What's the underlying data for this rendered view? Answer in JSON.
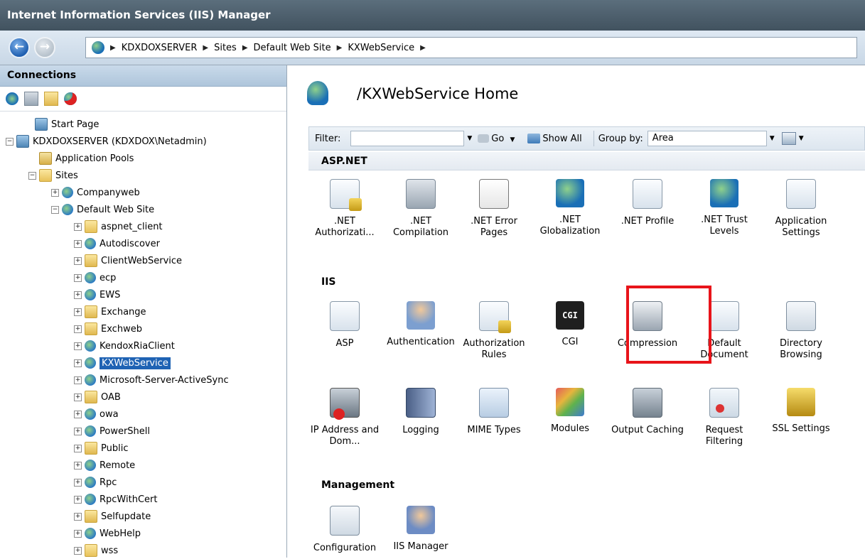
{
  "window": {
    "title": "Internet Information Services (IIS) Manager"
  },
  "address": {
    "crumbs": [
      "KDXDOXSERVER",
      "Sites",
      "Default Web Site",
      "KXWebService"
    ]
  },
  "connections": {
    "header": "Connections",
    "tree": [
      {
        "label": "Start Page",
        "level": 1,
        "icon": "start-page-icon"
      },
      {
        "label": "KDXDOXSERVER (KDXDOX\\Netadmin)",
        "level": 0,
        "icon": "server-icon",
        "expander": "−"
      },
      {
        "label": "Application Pools",
        "level": 1,
        "icon": "app-pool-icon"
      },
      {
        "label": "Sites",
        "level": 1,
        "icon": "sites-icon",
        "expander": "−"
      },
      {
        "label": "Companyweb",
        "level": 2,
        "icon": "site-globe-icon",
        "expander": "+"
      },
      {
        "label": "Default Web Site",
        "level": 2,
        "icon": "site-globe-icon",
        "expander": "−"
      },
      {
        "label": "aspnet_client",
        "level": 3,
        "icon": "folder-icon",
        "expander": "+"
      },
      {
        "label": "Autodiscover",
        "level": 3,
        "icon": "application-icon",
        "expander": "+"
      },
      {
        "label": "ClientWebService",
        "level": 3,
        "icon": "virtual-directory-icon",
        "expander": "+"
      },
      {
        "label": "ecp",
        "level": 3,
        "icon": "application-icon",
        "expander": "+"
      },
      {
        "label": "EWS",
        "level": 3,
        "icon": "application-icon",
        "expander": "+"
      },
      {
        "label": "Exchange",
        "level": 3,
        "icon": "virtual-directory-icon",
        "expander": "+"
      },
      {
        "label": "Exchweb",
        "level": 3,
        "icon": "virtual-directory-icon",
        "expander": "+"
      },
      {
        "label": "KendoxRiaClient",
        "level": 3,
        "icon": "application-icon",
        "expander": "+"
      },
      {
        "label": "KXWebService",
        "level": 3,
        "icon": "application-icon",
        "expander": "+",
        "selected": true
      },
      {
        "label": "Microsoft-Server-ActiveSync",
        "level": 3,
        "icon": "application-icon",
        "expander": "+"
      },
      {
        "label": "OAB",
        "level": 3,
        "icon": "virtual-directory-icon",
        "expander": "+"
      },
      {
        "label": "owa",
        "level": 3,
        "icon": "application-icon",
        "expander": "+"
      },
      {
        "label": "PowerShell",
        "level": 3,
        "icon": "application-icon",
        "expander": "+"
      },
      {
        "label": "Public",
        "level": 3,
        "icon": "virtual-directory-icon",
        "expander": "+"
      },
      {
        "label": "Remote",
        "level": 3,
        "icon": "application-icon",
        "expander": "+"
      },
      {
        "label": "Rpc",
        "level": 3,
        "icon": "application-icon",
        "expander": "+"
      },
      {
        "label": "RpcWithCert",
        "level": 3,
        "icon": "application-icon",
        "expander": "+"
      },
      {
        "label": "Selfupdate",
        "level": 3,
        "icon": "virtual-directory-icon",
        "expander": "+"
      },
      {
        "label": "WebHelp",
        "level": 3,
        "icon": "application-icon",
        "expander": "+"
      },
      {
        "label": "wss",
        "level": 3,
        "icon": "folder-icon",
        "expander": "+"
      }
    ]
  },
  "main": {
    "title": "/KXWebService Home",
    "filter": {
      "label": "Filter:",
      "go": "Go",
      "show_all": "Show All",
      "group_by_label": "Group by:",
      "group_by_value": "Area"
    },
    "sections": {
      "aspnet": "ASP.NET",
      "iis": "IIS",
      "management": "Management"
    },
    "features_aspnet": [
      {
        "label": ".NET Authorizati...",
        "icon": "net-authorization-icon"
      },
      {
        "label": ".NET Compilation",
        "icon": "net-compilation-icon"
      },
      {
        "label": ".NET Error Pages",
        "icon": "net-error-pages-icon"
      },
      {
        "label": ".NET Globalization",
        "icon": "net-globalization-icon"
      },
      {
        "label": ".NET Profile",
        "icon": "net-profile-icon"
      },
      {
        "label": ".NET Trust Levels",
        "icon": "net-trust-levels-icon"
      },
      {
        "label": "Application Settings",
        "icon": "application-settings-icon"
      }
    ],
    "features_iis_row1": [
      {
        "label": "ASP",
        "icon": "asp-icon"
      },
      {
        "label": "Authentication",
        "icon": "authentication-icon"
      },
      {
        "label": "Authorization Rules",
        "icon": "authorization-rules-icon"
      },
      {
        "label": "CGI",
        "icon": "cgi-icon"
      },
      {
        "label": "Compression",
        "icon": "compression-icon"
      },
      {
        "label": "Default Document",
        "icon": "default-document-icon"
      },
      {
        "label": "Directory Browsing",
        "icon": "directory-browsing-icon"
      }
    ],
    "features_iis_row2": [
      {
        "label": "IP Address and Dom...",
        "icon": "ip-address-icon"
      },
      {
        "label": "Logging",
        "icon": "logging-icon"
      },
      {
        "label": "MIME Types",
        "icon": "mime-types-icon"
      },
      {
        "label": "Modules",
        "icon": "modules-icon"
      },
      {
        "label": "Output Caching",
        "icon": "output-caching-icon"
      },
      {
        "label": "Request Filtering",
        "icon": "request-filtering-icon"
      },
      {
        "label": "SSL Settings",
        "icon": "ssl-settings-icon"
      }
    ],
    "features_mgmt": [
      {
        "label": "Configuration",
        "icon": "configuration-editor-icon"
      },
      {
        "label": "IIS Manager",
        "icon": "iis-manager-permissions-icon"
      }
    ],
    "cgi_badge": "CGI",
    "highlight_color": "#e8141a"
  }
}
